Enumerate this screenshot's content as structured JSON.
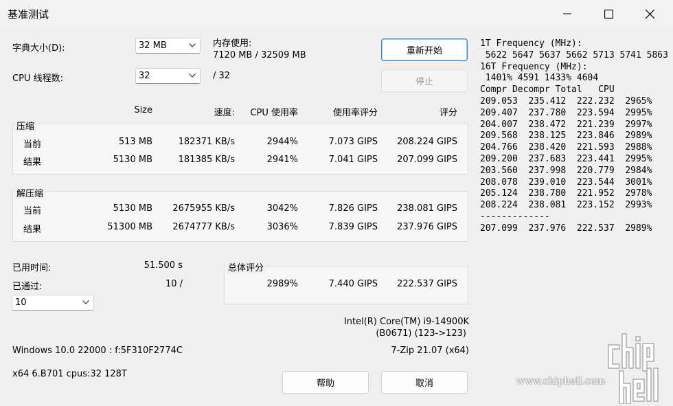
{
  "window": {
    "title": "基准测试",
    "controls": [
      "minimize-icon",
      "maximize-icon",
      "close-icon"
    ]
  },
  "settings": {
    "dict_label": "字典大小(D):",
    "dict_value": "32 MB",
    "threads_label": "CPU 线程数:",
    "threads_value": "32",
    "threads_max": "/ 32",
    "mem_label": "内存使用:",
    "mem_value": "7120 MB / 32509 MB"
  },
  "buttons": {
    "restart": "重新开始",
    "stop": "停止",
    "help": "帮助",
    "cancel": "取消"
  },
  "table": {
    "headers": [
      "Size",
      "速度:",
      "CPU 使用率",
      "使用率评分",
      "评分"
    ],
    "compress": {
      "label": "压缩",
      "rows": [
        {
          "name": "当前",
          "size": "513 MB",
          "speed": "182371 KB/s",
          "cpu": "2944%",
          "rating_usage": "7.073 GIPS",
          "rating": "208.224 GIPS"
        },
        {
          "name": "结果",
          "size": "5130 MB",
          "speed": "181385 KB/s",
          "cpu": "2941%",
          "rating_usage": "7.041 GIPS",
          "rating": "207.099 GIPS"
        }
      ]
    },
    "decompress": {
      "label": "解压缩",
      "rows": [
        {
          "name": "当前",
          "size": "5130 MB",
          "speed": "2675955 KB/s",
          "cpu": "3042%",
          "rating_usage": "7.826 GIPS",
          "rating": "238.081 GIPS"
        },
        {
          "name": "结果",
          "size": "51300 MB",
          "speed": "2674777 KB/s",
          "cpu": "3036%",
          "rating_usage": "7.839 GIPS",
          "rating": "237.976 GIPS"
        }
      ]
    }
  },
  "status": {
    "elapsed_label": "已用时间:",
    "elapsed_value": "51.500 s",
    "passed_label": "已通过:",
    "passed_value": "10 /",
    "passes_select": "10"
  },
  "total": {
    "label": "总体评分",
    "cpu": "2989%",
    "rating_usage": "7.440 GIPS",
    "rating": "222.537 GIPS"
  },
  "system": {
    "cpu_name": "Intel(R) Core(TM) i9-14900K",
    "cpu_id": "(B0671) (123->123)",
    "os": "Windows 10.0 22000 :  f:5F310F2774C",
    "version": "7-Zip 21.07 (x64)",
    "arch": "x64 6.B701 cpus:32 128T"
  },
  "log": {
    "lines": [
      "1T Frequency (MHz):",
      " 5622 5647 5637 5662 5713 5741 5863",
      "16T Frequency (MHz):",
      " 1401% 4591 1433% 4604",
      "Compr Decompr Total   CPU",
      "209.053  235.412  222.232  2965%",
      "209.407  237.780  223.594  2995%",
      "204.007  238.472  221.239  2997%",
      "209.568  238.125  223.846  2989%",
      "204.766  238.420  221.593  2988%",
      "209.200  237.683  223.441  2995%",
      "203.560  237.998  220.779  2984%",
      "208.078  239.010  223.544  3001%",
      "205.124  238.780  221.952  2978%",
      "208.224  238.081  223.152  2993%",
      "-------------",
      "207.099  237.976  222.537  2989%"
    ]
  },
  "watermark": {
    "text": "www.chiphell.com",
    "logo": "chiphell"
  }
}
